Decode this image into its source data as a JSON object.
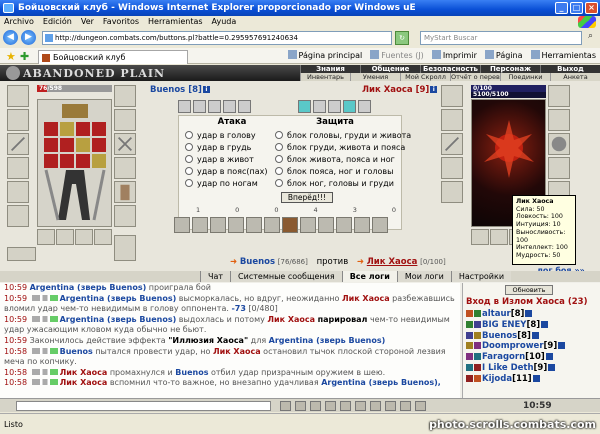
{
  "window": {
    "title": "Бойцовский клуб - Windows Internet Explorer proporcionado por Windows uE",
    "controls": [
      "_",
      "□",
      "×"
    ]
  },
  "menu": [
    "Archivo",
    "Edición",
    "Ver",
    "Favoritos",
    "Herramientas",
    "Ayuda"
  ],
  "address": {
    "url": "http://dungeon.combats.com/buttons.pl?battle=0.295957691240634",
    "search_placeholder": "MyStart Buscar"
  },
  "tab": {
    "label": "Бойцовский клуб",
    "commands": [
      "Página principal",
      "Fuentes (J)",
      "Imprimir",
      "Página",
      "Herramientas"
    ]
  },
  "game": {
    "logo": "ABANDONED PLAIN",
    "topnav": [
      "Знания",
      "Общение",
      "Безопасность",
      "Персонаж",
      "Выход"
    ],
    "subnav": [
      "Инвентарь",
      "Умения",
      "Мой Скролл",
      "Отчёт о переводах",
      "Поединки",
      "Анкета"
    ],
    "left_fighter": {
      "name": "Buenos",
      "level": "[8]",
      "hp": "76/598",
      "hp_fraction": 0.127,
      "hp_color": "#c02020"
    },
    "right_fighter": {
      "name": "Лик Хаоса",
      "level": "[9]",
      "hp": "0/100",
      "mp": "5100/5100",
      "hp_fraction": 0.0,
      "stats": {
        "name": "Лик Хаоса",
        "lines": [
          "Сила: 50",
          "Ловкость: 100",
          "Интуиция: 10",
          "Выносливость: 100",
          "Интеллект: 100",
          "Мудрость: 50"
        ]
      }
    },
    "attack_header": "Атака",
    "defense_header": "Защита",
    "attacks": [
      "удар в голову",
      "удар в грудь",
      "удар в живот",
      "удар в пояс(пах)",
      "удар по ногам"
    ],
    "defenses": [
      "блок головы, груди и живота",
      "блок груди, живота и пояса",
      "блок живота, пояса и ног",
      "блок пояса, ног и головы",
      "блок ног, головы и груди"
    ],
    "go_button": "Вперёд!!!",
    "counters": [
      "1",
      "0",
      "0",
      "4",
      "3",
      "0"
    ],
    "vs": {
      "left_name": "Buenos",
      "left_hp": "[76/686]",
      "word": "против",
      "right_name": "Лик Хаоса",
      "right_hp": "[0/100]"
    },
    "boys_link": "лог боя »»"
  },
  "chat": {
    "tabs": [
      "Чат",
      "Системные сообщения",
      "Все логи",
      "Мои логи",
      "Настройки"
    ],
    "active_tab": 2,
    "messages": [
      {
        "time": "10:59",
        "parts": [
          [
            "a",
            "Argentina (зверь Buenos)"
          ],
          [
            "n",
            " проиграла бой"
          ]
        ],
        "pre": false
      },
      {
        "time": "10:59",
        "parts": [
          [
            "a",
            "Argentina (зверь Buenos)"
          ],
          [
            "n",
            " высморкалась, но вдруг, неожиданно "
          ],
          [
            "h",
            "Лик Хаоса"
          ],
          [
            "n",
            " разбежавшись"
          ]
        ],
        "pre": true
      },
      {
        "time": "",
        "parts": [
          [
            "n",
            "вломил удар чем-то невидимым в голову оппонента. "
          ],
          [
            "dmg",
            "-73"
          ],
          [
            "n",
            " [0/480]"
          ]
        ],
        "pre": false
      },
      {
        "time": "10:59",
        "parts": [
          [
            "a",
            "Argentina (зверь Buenos)"
          ],
          [
            "n",
            " выдохлась и потому "
          ],
          [
            "h",
            "Лик Хаоса"
          ],
          [
            "n",
            " "
          ],
          [
            "b",
            "парировал"
          ],
          [
            "n",
            " чем-то невидимым"
          ]
        ],
        "pre": true
      },
      {
        "time": "",
        "parts": [
          [
            "n",
            "удар ужасающим кловом куда обычно не бьют."
          ]
        ],
        "pre": false
      },
      {
        "time": "10:59",
        "parts": [
          [
            "n",
            "Закончилось действие эффекта "
          ],
          [
            "b",
            "\"Иллюзия Хаоса\""
          ],
          [
            "n",
            " для "
          ],
          [
            "a",
            "Argentina (зверь Buenos)"
          ]
        ],
        "pre": false
      },
      {
        "time": "10:58",
        "parts": [
          [
            "a",
            "Buenos"
          ],
          [
            "n",
            " пытался провести удар, но "
          ],
          [
            "h",
            "Лик Хаоса"
          ],
          [
            "n",
            " остановил тычок плоской стороной лезвия"
          ]
        ],
        "pre": true
      },
      {
        "time": "",
        "parts": [
          [
            "n",
            "меча по копчику."
          ]
        ],
        "pre": false
      },
      {
        "time": "10:58",
        "parts": [
          [
            "h",
            "Лик Хаоса"
          ],
          [
            "n",
            " промахнулся и "
          ],
          [
            "a",
            "Buenos"
          ],
          [
            "n",
            " отбил удар призрачным оружием в шею."
          ]
        ],
        "pre": true
      },
      {
        "time": "10:58",
        "parts": [
          [
            "h",
            "Лик Хаоса"
          ],
          [
            "n",
            " вспомнил что-то важное, но внезапно удачливая "
          ],
          [
            "a",
            "Argentina (зверь Buenos),"
          ]
        ],
        "pre": true
      }
    ]
  },
  "online": {
    "refresh": "Обновить",
    "header": "Вход в Излом Хаоса (23)",
    "users": [
      {
        "name": "altaur",
        "level": "[8]",
        "color": "#1b48a0"
      },
      {
        "name": "BIG ENEY",
        "level": "[8]",
        "color": "#1b48a0"
      },
      {
        "name": "Buenos",
        "level": "[8]",
        "color": "#1b48a0"
      },
      {
        "name": "Doomprower",
        "level": "[9]",
        "color": "#1b48a0"
      },
      {
        "name": "Faragorn",
        "level": "[10]",
        "color": "#1b48a0"
      },
      {
        "name": "I Like Deth",
        "level": "[9]",
        "color": "#1b48a0"
      },
      {
        "name": "Kijoda",
        "level": "[11]",
        "color": "#1b48a0"
      }
    ]
  },
  "toolbar": {
    "clock": "10:59"
  },
  "status": {
    "text": "Listo",
    "watermark": "photo.scrolls.combats.com"
  }
}
